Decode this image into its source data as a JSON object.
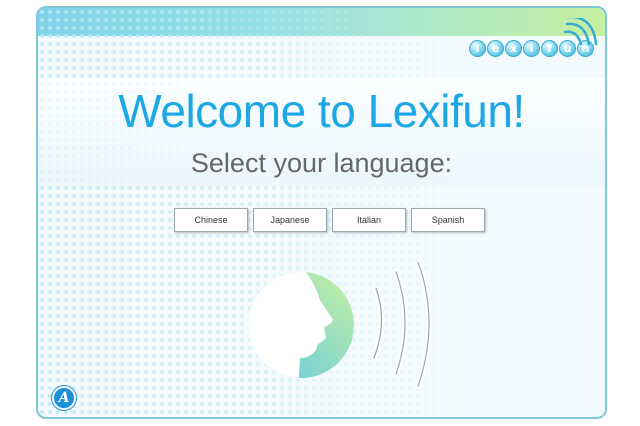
{
  "header": {
    "title": "Welcome to Lexifun!",
    "subtitle": "Select your language:"
  },
  "logo": {
    "letters": [
      "l",
      "e",
      "x",
      "i",
      "f",
      "u",
      "n"
    ]
  },
  "languages": [
    {
      "label": "Chinese"
    },
    {
      "label": "Japanese"
    },
    {
      "label": "Italian"
    },
    {
      "label": "Spanish"
    }
  ],
  "footer": {
    "badge_letter": "A"
  },
  "icons": {
    "speaker": "speaking-head-icon",
    "logo_waves": "sound-waves-icon"
  },
  "colors": {
    "title": "#1ca8e4",
    "subtitle": "#666666",
    "bar_start": "#7fd4ea",
    "bar_end": "#c6f0a0",
    "badge": "#1c8fd8"
  }
}
